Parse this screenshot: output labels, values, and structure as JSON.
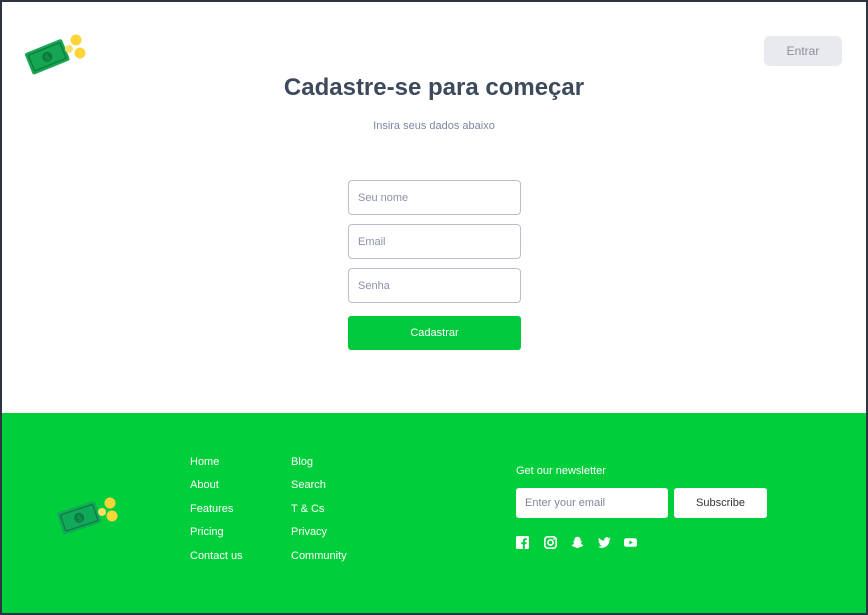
{
  "header": {
    "login_label": "Entrar"
  },
  "main": {
    "title": "Cadastre-se para começar",
    "subtitle": "Insira seus dados abaixo",
    "form": {
      "name_placeholder": "Seu nome",
      "email_placeholder": "Email",
      "password_placeholder": "Senha",
      "submit_label": "Cadastrar"
    }
  },
  "footer": {
    "links_col1": [
      "Home",
      "About",
      "Features",
      "Pricing",
      "Contact us"
    ],
    "links_col2": [
      "Blog",
      "Search",
      "T & Cs",
      "Privacy",
      "Community"
    ],
    "newsletter": {
      "title": "Get our newsletter",
      "email_placeholder": "Enter your email",
      "subscribe_label": "Subscribe"
    },
    "social_icons": [
      "facebook-icon",
      "instagram-icon",
      "snapchat-icon",
      "twitter-icon",
      "youtube-icon"
    ]
  },
  "colors": {
    "brand_green": "#00cf3b",
    "button_green": "#00c93e",
    "title_text": "#3d4a5c",
    "money_green": "#1fae5b",
    "coin_yellow": "#ffd43b"
  }
}
